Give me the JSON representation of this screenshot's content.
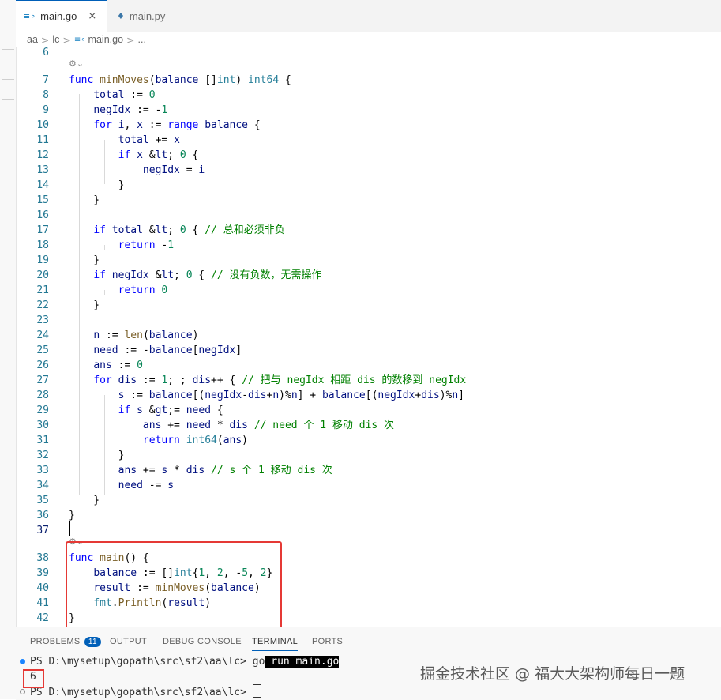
{
  "tabs": [
    {
      "icon": "go-icon",
      "icon_glyph": "≡∘",
      "label": "main.go",
      "close": "×"
    },
    {
      "icon": "python-icon",
      "icon_glyph": "♦",
      "label": "main.py"
    }
  ],
  "breadcrumb": {
    "parts": [
      "aa",
      "lc",
      "main.go",
      "..."
    ],
    "separator": ">",
    "file_icon_glyph": "≡∘"
  },
  "codelens_glyph": "⚙⌄",
  "code_lines": [
    {
      "num": "6",
      "text": ""
    },
    {
      "num": "7",
      "text": "func minMoves(balance []int) int64 {"
    },
    {
      "num": "8",
      "text": "    total := 0"
    },
    {
      "num": "9",
      "text": "    negIdx := -1"
    },
    {
      "num": "10",
      "text": "    for i, x := range balance {"
    },
    {
      "num": "11",
      "text": "        total += x"
    },
    {
      "num": "12",
      "text": "        if x < 0 {"
    },
    {
      "num": "13",
      "text": "            negIdx = i"
    },
    {
      "num": "14",
      "text": "        }"
    },
    {
      "num": "15",
      "text": "    }"
    },
    {
      "num": "16",
      "text": ""
    },
    {
      "num": "17",
      "text": "    if total < 0 { // 总和必须非负"
    },
    {
      "num": "18",
      "text": "        return -1"
    },
    {
      "num": "19",
      "text": "    }"
    },
    {
      "num": "20",
      "text": "    if negIdx < 0 { // 没有负数，无需操作"
    },
    {
      "num": "21",
      "text": "        return 0"
    },
    {
      "num": "22",
      "text": "    }"
    },
    {
      "num": "23",
      "text": ""
    },
    {
      "num": "24",
      "text": "    n := len(balance)"
    },
    {
      "num": "25",
      "text": "    need := -balance[negIdx]"
    },
    {
      "num": "26",
      "text": "    ans := 0"
    },
    {
      "num": "27",
      "text": "    for dis := 1; ; dis++ { // 把与 negIdx 相距 dis 的数移到 negIdx"
    },
    {
      "num": "28",
      "text": "        s := balance[(negIdx-dis+n)%n] + balance[(negIdx+dis)%n]"
    },
    {
      "num": "29",
      "text": "        if s >= need {"
    },
    {
      "num": "30",
      "text": "            ans += need * dis // need 个 1 移动 dis 次"
    },
    {
      "num": "31",
      "text": "            return int64(ans)"
    },
    {
      "num": "32",
      "text": "        }"
    },
    {
      "num": "33",
      "text": "        ans += s * dis // s 个 1 移动 dis 次"
    },
    {
      "num": "34",
      "text": "        need -= s"
    },
    {
      "num": "35",
      "text": "    }"
    },
    {
      "num": "36",
      "text": "}"
    },
    {
      "num": "37",
      "text": ""
    },
    {
      "num": "38",
      "text": "func main() {"
    },
    {
      "num": "39",
      "text": "    balance := []int{1, 2, -5, 2}"
    },
    {
      "num": "40",
      "text": "    result := minMoves(balance)"
    },
    {
      "num": "41",
      "text": "    fmt.Println(result)"
    },
    {
      "num": "42",
      "text": "}"
    }
  ],
  "panel": {
    "tabs": [
      "PROBLEMS",
      "OUTPUT",
      "DEBUG CONSOLE",
      "TERMINAL",
      "PORTS"
    ],
    "problems_count": "11",
    "active_tab": "TERMINAL"
  },
  "terminal": {
    "prompt": "PS D:\\mysetup\\gopath\\src\\sf2\\aa\\lc> ",
    "command_go": "go",
    "command_rest": " run main.go",
    "output": "6"
  },
  "watermark": "掘金技术社区 @ 福大大架构师每日一题",
  "colors": {
    "accent": "#005fb8",
    "annotation_red": "#e53935",
    "line_number": "#237893"
  }
}
